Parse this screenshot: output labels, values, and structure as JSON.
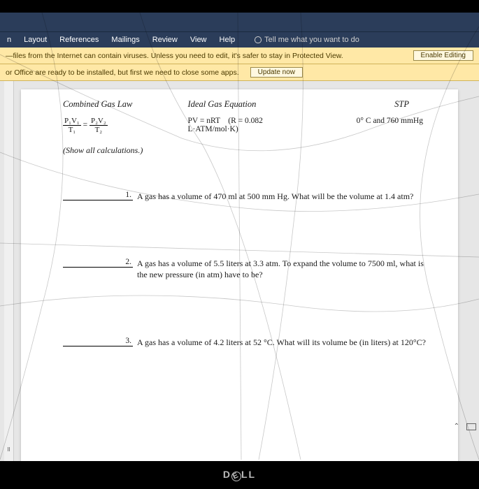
{
  "header": {
    "title_obscured": ""
  },
  "ribbon": {
    "tabs": [
      "n",
      "Layout",
      "References",
      "Mailings",
      "Review",
      "View",
      "Help"
    ],
    "tell_me": "Tell me what you want to do"
  },
  "protected_view": {
    "message": "—files from the Internet can contain viruses. Unless you need to edit, it's safer to stay in Protected View.",
    "button": "Enable Editing"
  },
  "office_install": {
    "message": "or Office are ready to be installed, but first we need to close some apps.",
    "button": "Update now"
  },
  "document": {
    "col_headers": {
      "c1": "Combined Gas Law",
      "c2": "Ideal Gas Equation",
      "c3": "STP"
    },
    "formulas": {
      "combined_left_top": "P₁V₁",
      "combined_left_bot": "T₁",
      "combined_eq": "=",
      "combined_right_top": "P₂V₂",
      "combined_right_bot": "T₂",
      "ideal": "PV = nRT",
      "r_value": "(R = 0.082 L·ATM/mol·K)",
      "stp": "0° C and 760 mmHg"
    },
    "show_calc": "(Show all calculations.)",
    "questions": [
      {
        "num": "1.",
        "text": "A gas has a volume of 470 ml at 500 mm Hg. What will be the volume at 1.4 atm?"
      },
      {
        "num": "2.",
        "text": "A gas has a volume of 5.5 liters at 3.3 atm. To expand the volume to 7500 ml, what is the new pressure (in atm) have to be?"
      },
      {
        "num": "3.",
        "text": "A gas has a volume of 4.2 liters at 52 °C. What will its volume be (in liters) at 120°C?"
      }
    ]
  },
  "ruler_mark": "II",
  "brand": {
    "d": "D",
    "e": "E",
    "ll": "LL"
  }
}
